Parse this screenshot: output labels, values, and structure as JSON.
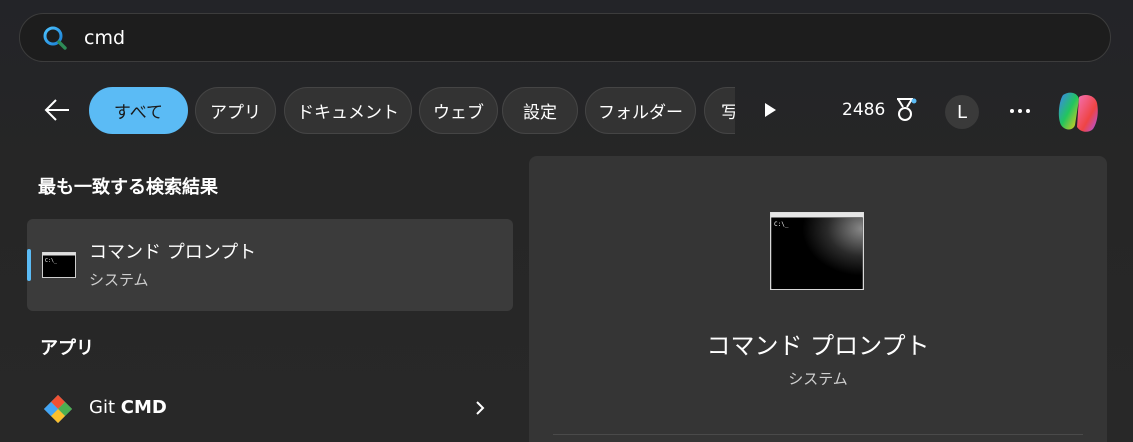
{
  "search": {
    "value": "cmd",
    "icon": "search-icon"
  },
  "filters": {
    "chips": [
      {
        "label": "すべて",
        "active": true
      },
      {
        "label": "アプリ",
        "active": false
      },
      {
        "label": "ドキュメント",
        "active": false
      },
      {
        "label": "ウェブ",
        "active": false
      },
      {
        "label": "設定",
        "active": false
      },
      {
        "label": "フォルダー",
        "active": false
      },
      {
        "label": "写",
        "active": false
      }
    ]
  },
  "header": {
    "points": "2486",
    "avatar_initial": "L"
  },
  "best_match": {
    "heading": "最も一致する検索結果",
    "title": "コマンド プロンプト",
    "subtitle": "システム"
  },
  "apps": {
    "heading": "アプリ",
    "items": [
      {
        "name_prefix": "Git ",
        "name_bold": "CMD"
      }
    ]
  },
  "preview": {
    "title": "コマンド プロンプト",
    "subtitle": "システム"
  },
  "colors": {
    "accent": "#5bbbf5",
    "background": "#262626",
    "card": "#3b3b3b",
    "panel": "#353535"
  }
}
